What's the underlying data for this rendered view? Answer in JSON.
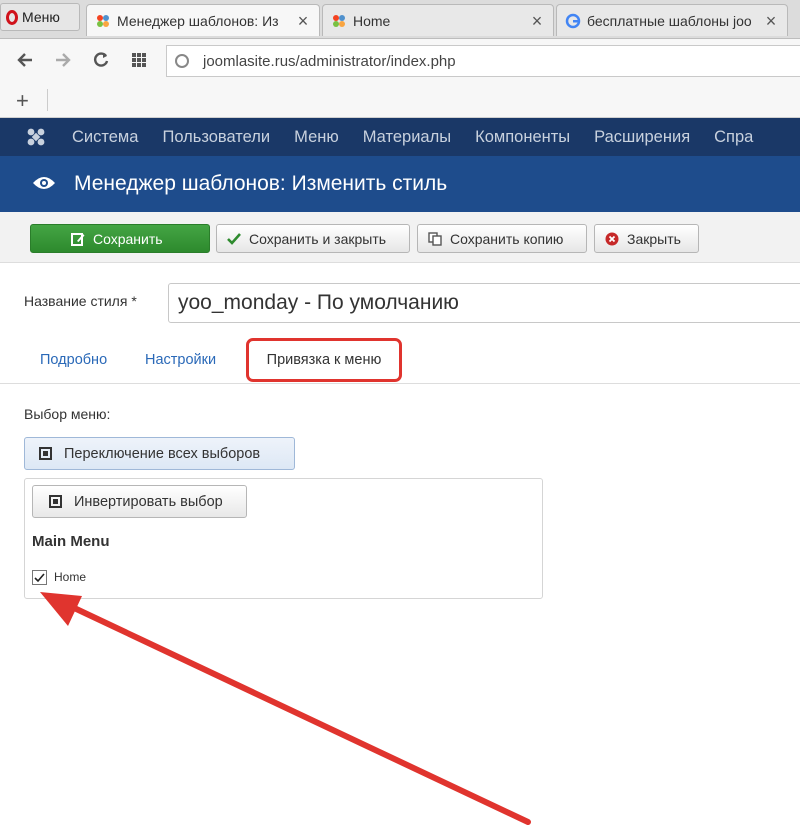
{
  "browser": {
    "menu_label": "Меню",
    "tabs": [
      {
        "title": "Менеджер шаблонов: Из",
        "favicon": "joomla-icon",
        "active": true
      },
      {
        "title": "Home",
        "favicon": "joomla-icon",
        "active": false
      },
      {
        "title": "бесплатные шаблоны joo",
        "favicon": "google-icon",
        "active": false
      }
    ],
    "close_glyph": "×",
    "url": "joomlasite.rus/administrator/index.php",
    "new_tab_glyph": "+"
  },
  "joomla_menu": {
    "items": [
      "Система",
      "Пользователи",
      "Меню",
      "Материалы",
      "Компоненты",
      "Расширения",
      "Спра"
    ]
  },
  "page": {
    "title": "Менеджер шаблонов: Изменить стиль"
  },
  "toolbar": {
    "save": "Сохранить",
    "save_close": "Сохранить и закрыть",
    "save_copy": "Сохранить копию",
    "close": "Закрыть"
  },
  "form": {
    "style_label": "Название стиля *",
    "style_value": "yoo_monday - По умолчанию",
    "tabs": [
      "Подробно",
      "Настройки",
      "Привязка к меню"
    ],
    "menu_select_label": "Выбор меню:",
    "toggle_all": "Переключение всех выборов",
    "invert": "Инвертировать выбор",
    "menu_group": "Main Menu",
    "menu_item": "Home",
    "menu_item_checked": true
  },
  "colors": {
    "joomla_nav": "#1a3867",
    "joomla_header": "#1e4c8c",
    "save_green": "#3a9a3a",
    "highlight_red": "#e0342e"
  }
}
